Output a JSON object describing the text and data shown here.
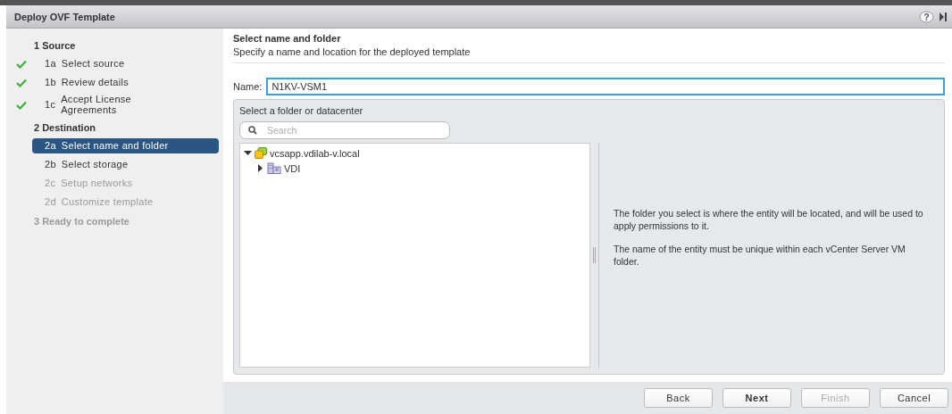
{
  "window": {
    "title": "Deploy OVF Template",
    "help_glyph": "?"
  },
  "steps": [
    {
      "kind": "section",
      "label": "1 Source",
      "disabled": false,
      "children": [
        {
          "kind": "step",
          "number": "1a",
          "label": "Select source",
          "done": true,
          "selected": false,
          "disabled": false
        },
        {
          "kind": "step",
          "number": "1b",
          "label": "Review details",
          "done": true,
          "selected": false,
          "disabled": false
        },
        {
          "kind": "step",
          "number": "1c",
          "label": "Accept License Agreements",
          "done": true,
          "selected": false,
          "disabled": false
        }
      ]
    },
    {
      "kind": "section",
      "label": "2 Destination",
      "disabled": false,
      "children": [
        {
          "kind": "step",
          "number": "2a",
          "label": "Select name and folder",
          "done": false,
          "selected": true,
          "disabled": false
        },
        {
          "kind": "step",
          "number": "2b",
          "label": "Select storage",
          "done": false,
          "selected": false,
          "disabled": false
        },
        {
          "kind": "step",
          "number": "2c",
          "label": "Setup networks",
          "done": false,
          "selected": false,
          "disabled": true
        },
        {
          "kind": "step",
          "number": "2d",
          "label": "Customize template",
          "done": false,
          "selected": false,
          "disabled": true
        }
      ]
    },
    {
      "kind": "section",
      "label": "3 Ready to complete",
      "disabled": true
    }
  ],
  "page": {
    "title": "Select name and folder",
    "subtitle": "Specify a name and location for the deployed template"
  },
  "name_field": {
    "label": "Name:",
    "value": "N1KV-VSM1"
  },
  "folder_panel": {
    "title": "Select a folder or datacenter",
    "search": {
      "placeholder": "Search"
    },
    "tree": [
      {
        "kind": "vcenter",
        "label": "vcsapp.vdilab-v.local",
        "expanded": true,
        "children": [
          {
            "kind": "datacenter",
            "label": "VDI",
            "expanded": false
          }
        ]
      }
    ],
    "help": [
      "The folder you select is where the entity will be located, and will be used to apply permissions to it.",
      "The name of the entity must be unique within each vCenter Server VM folder."
    ]
  },
  "buttons": [
    {
      "label": "Back",
      "primary": false,
      "disabled": false
    },
    {
      "label": "Next",
      "primary": true,
      "disabled": false
    },
    {
      "label": "Finish",
      "primary": false,
      "disabled": true
    },
    {
      "label": "Cancel",
      "primary": false,
      "disabled": false
    }
  ]
}
